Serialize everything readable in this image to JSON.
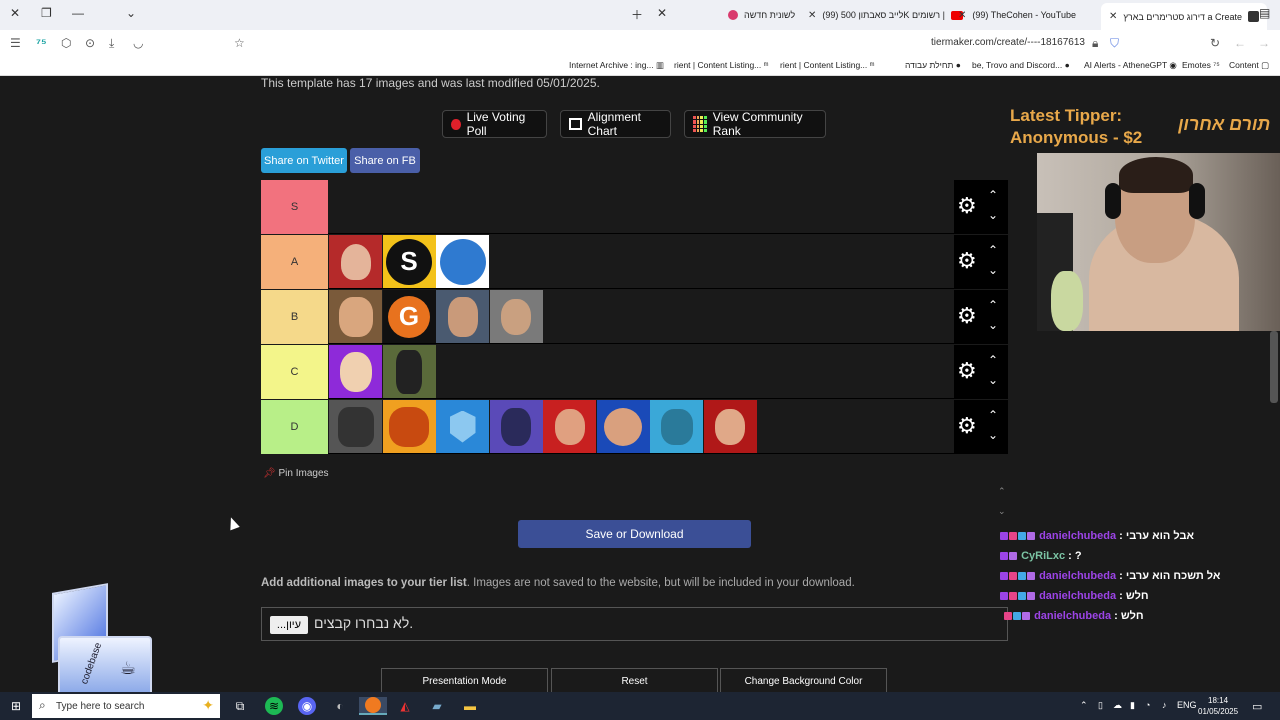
{
  "browser": {
    "tabs": [
      {
        "title": "דירוג סטרימרים בארץ a Create",
        "active": true
      },
      {
        "title": "(99) TheCohen - YouTube",
        "active": false
      },
      {
        "title": "(99) לייב סאבתון 500K רשומים |",
        "active": false
      },
      {
        "title": "לשונית חדשה",
        "active": false
      }
    ],
    "url": "tiermaker.com/create/----18167613",
    "bookmarks": [
      "Content",
      "Emotes",
      "AI Alerts - AtheneGPT",
      "be, Trovo and Discord...",
      "תחילת עבודה",
      "rient | Content Listing...",
      "rient | Content Listing...",
      "Internet Archive : ing..."
    ]
  },
  "page": {
    "info_text": "This template has 17 images and was last modified 05/01/2025.",
    "buttons": {
      "live_voting": "Live Voting Poll",
      "alignment_chart": "Alignment Chart",
      "community_rank": "View Community Rank",
      "share_twitter": "Share on Twitter",
      "share_fb": "Share on FB",
      "pin_images": "Pin Images",
      "save_download": "Save or Download",
      "presentation_mode": "Presentation Mode",
      "reset": "Reset",
      "change_bg": "Change Background Color"
    },
    "tiers": [
      {
        "label": "S",
        "color": "#f2727e",
        "items": []
      },
      {
        "label": "A",
        "color": "#f5b07a",
        "items": [
          "img-a1",
          "img-a2",
          "img-a3"
        ]
      },
      {
        "label": "B",
        "color": "#f5d98a",
        "items": [
          "img-b1",
          "img-b2",
          "img-b3",
          "img-b4"
        ]
      },
      {
        "label": "C",
        "color": "#f3f58a",
        "items": [
          "img-c1",
          "img-c2"
        ]
      },
      {
        "label": "D",
        "color": "#b8ef88",
        "items": [
          "img-d1",
          "img-d2",
          "img-d3",
          "img-d4",
          "img-d5",
          "img-d6",
          "img-d7",
          "img-d8"
        ]
      }
    ],
    "add_images_bold": "Add additional images to your tier list",
    "add_images_text": ". Images are not saved to the website, but will be included in your download.",
    "file_button": "...עיון",
    "file_status": "לא נבחרו קבצים."
  },
  "overlay": {
    "tipper_title": "Latest Tipper:",
    "tipper_name": "Anonymous - $2",
    "tipper_hebrew": "תורם אחרון",
    "chat": [
      {
        "user": "danielchubeda",
        "message": "אבל הוא ערבי"
      },
      {
        "user": "CyRiLxc",
        "message": "?"
      },
      {
        "user": "danielchubeda",
        "message": "אל תשכח הוא ערבי"
      },
      {
        "user": "danielchubeda",
        "message": "חלש"
      },
      {
        "user": "danielchubeda",
        "message": "חלש"
      }
    ],
    "deco_label": "codebase"
  },
  "taskbar": {
    "search_placeholder": "Type here to search",
    "lang": "ENG",
    "time": "18:14",
    "date": "01/05/2025"
  }
}
